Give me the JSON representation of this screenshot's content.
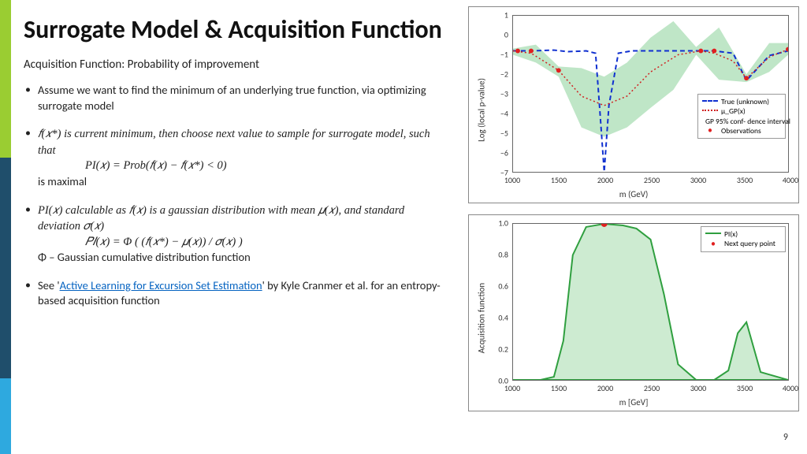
{
  "title": "Surrogate Model & Acquisition Function",
  "subtitle": "Acquisition Function: Probability of improvement",
  "bullets": {
    "b1": "Assume we want to find the minimum of an underlying true function, via optimizing surrogate model",
    "b2_pre": "𝑓(𝑥*) is current minimum, then choose next value to sample for surrogate model, such that",
    "b2_eq": "PI(𝑥) = Prob(𝑓(𝑥) − 𝑓(𝑥*) < 0)",
    "b2_post": "is maximal",
    "b3_pre": "PI(𝑥) calculable as 𝑓(𝑥) is a gaussian distribution with mean 𝜇(𝑥), and standard deviation 𝜎(𝑥)",
    "b3_eq": "𝑃𝐼(𝑥) = Φ ( (𝑓(𝑥*) − 𝜇(𝑥)) / 𝜎(𝑥) )",
    "b3_post": "Φ – Gaussian cumulative distribution function",
    "b4_pre": "See '",
    "b4_link": "Active Learning for Excursion Set Estimation",
    "b4_post": "' by Kyle Cranmer et al. for an entropy-based acquisition function"
  },
  "page_number": "9",
  "chart_data": [
    {
      "type": "line",
      "title": "",
      "xlabel": "m (GeV)",
      "ylabel": "Log (local p-value)",
      "xlim": [
        1000,
        4000
      ],
      "ylim": [
        -7,
        1
      ],
      "xticks": [
        1000,
        1500,
        2000,
        2500,
        3000,
        3500,
        4000
      ],
      "yticks": [
        -7,
        -6,
        -5,
        -4,
        -3,
        -2,
        -1,
        0,
        1
      ],
      "series": [
        {
          "name": "True (unknown)",
          "style": "dashed-blue",
          "x": [
            1000,
            1200,
            1450,
            1600,
            1800,
            1900,
            1950,
            2000,
            2050,
            2150,
            2300,
            2600,
            2900,
            3200,
            3400,
            3550,
            3800,
            4000
          ],
          "y": [
            -0.7,
            -0.7,
            -0.65,
            -0.75,
            -0.7,
            -0.8,
            -3.5,
            -7.0,
            -3.5,
            -0.8,
            -0.7,
            -0.7,
            -0.7,
            -0.7,
            -0.8,
            -2.2,
            -0.9,
            -0.7
          ]
        },
        {
          "name": "μ_GP(x)",
          "style": "dotted-red",
          "x": [
            1000,
            1200,
            1500,
            1750,
            2000,
            2250,
            2500,
            2800,
            3050,
            3200,
            3400,
            3550,
            3800,
            4000
          ],
          "y": [
            -0.7,
            -0.8,
            -1.7,
            -3.0,
            -3.5,
            -3.0,
            -1.8,
            -0.9,
            -0.7,
            -0.8,
            -1.2,
            -2.1,
            -1.0,
            -0.6
          ]
        },
        {
          "name": "GP 95% conf- dence interval",
          "style": "fill-green",
          "upper_x": [
            1000,
            1250,
            1500,
            1750,
            2000,
            2250,
            2500,
            2750,
            3000,
            3250,
            3550,
            3800,
            4000
          ],
          "upper_y": [
            -0.5,
            -0.3,
            -1.4,
            -1.5,
            -2.0,
            -1.3,
            0.0,
            0.8,
            -0.5,
            0.5,
            -1.9,
            -0.3,
            -0.3
          ],
          "lower_x": [
            1000,
            1250,
            1500,
            1750,
            2000,
            2250,
            2500,
            2750,
            3000,
            3250,
            3550,
            3800,
            4000
          ],
          "lower_y": [
            -0.9,
            -1.3,
            -2.0,
            -4.6,
            -5.1,
            -4.6,
            -3.6,
            -2.7,
            -0.9,
            -2.2,
            -2.3,
            -1.8,
            -0.9
          ]
        },
        {
          "name": "Observations",
          "style": "points-red",
          "x": [
            1050,
            1200,
            1500,
            3050,
            3200,
            3550,
            4000
          ],
          "y": [
            -0.7,
            -0.7,
            -1.7,
            -0.7,
            -0.7,
            -2.1,
            -0.6
          ]
        }
      ],
      "legend": [
        "True (unknown)",
        "μ_GP(x)",
        "GP 95% conf- dence interval",
        "Observations"
      ]
    },
    {
      "type": "area",
      "title": "",
      "xlabel": "m [GeV]",
      "ylabel": "Acquisition function",
      "xlim": [
        1000,
        4000
      ],
      "ylim": [
        0.0,
        1.0
      ],
      "xticks": [
        1000,
        1500,
        2000,
        2500,
        3000,
        3500,
        4000
      ],
      "yticks": [
        0.0,
        0.2,
        0.4,
        0.6,
        0.8,
        1.0
      ],
      "series": [
        {
          "name": "PI(x)",
          "style": "line-green-fill",
          "x": [
            1000,
            1300,
            1450,
            1550,
            1650,
            1800,
            2000,
            2200,
            2350,
            2500,
            2650,
            2800,
            3000,
            3200,
            3350,
            3450,
            3550,
            3700,
            4000
          ],
          "y": [
            0.0,
            0.0,
            0.02,
            0.25,
            0.8,
            0.98,
            1.0,
            0.99,
            0.97,
            0.9,
            0.55,
            0.1,
            0.0,
            0.0,
            0.06,
            0.3,
            0.37,
            0.05,
            0.0
          ]
        },
        {
          "name": "Next query point",
          "style": "point-red",
          "x": [
            2000
          ],
          "y": [
            1.0
          ]
        }
      ],
      "legend": [
        "PI(x)",
        "Next query point"
      ]
    }
  ]
}
